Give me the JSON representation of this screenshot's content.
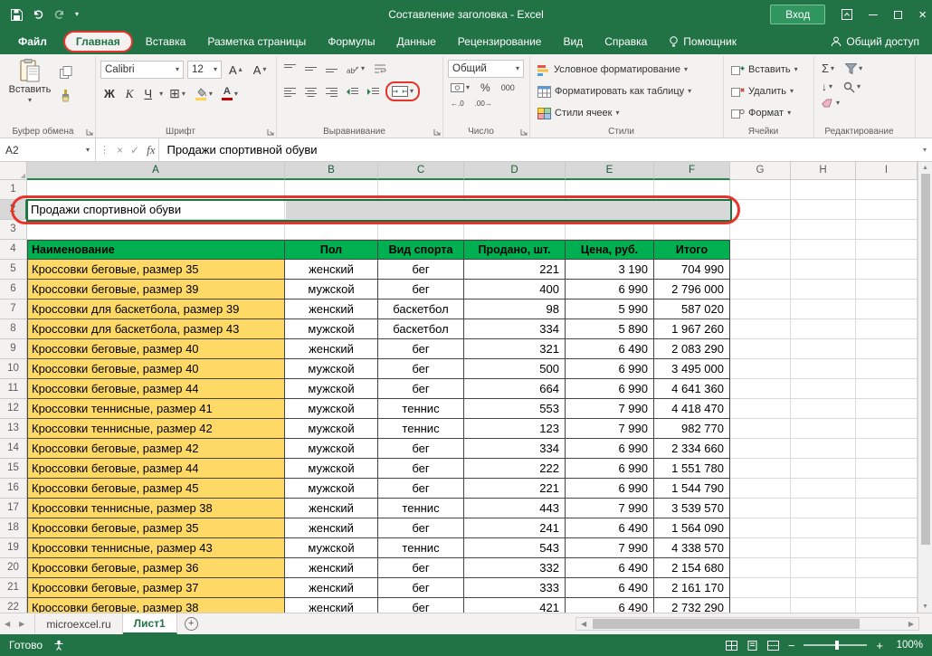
{
  "colors": {
    "excel_green": "#217346",
    "table_header_fill": "#00b050",
    "name_column_fill": "#ffd966",
    "selection_fill": "#d8d8d8",
    "annotation_red": "#e8352b"
  },
  "titlebar": {
    "title": "Составление заголовка  -  Excel",
    "sign_in": "Вход"
  },
  "tabs": {
    "file": "Файл",
    "items": [
      "Главная",
      "Вставка",
      "Разметка страницы",
      "Формулы",
      "Данные",
      "Рецензирование",
      "Вид",
      "Справка"
    ],
    "active": "Главная",
    "assistant": "Помощник",
    "share": "Общий доступ"
  },
  "ribbon": {
    "clipboard": {
      "label": "Буфер обмена",
      "paste": "Вставить"
    },
    "font": {
      "label": "Шрифт",
      "name": "Calibri",
      "size": "12",
      "bold": "Ж",
      "italic": "К",
      "underline": "Ч",
      "letter": "А"
    },
    "alignment": {
      "label": "Выравнивание",
      "wrap": "ab"
    },
    "number": {
      "label": "Число",
      "format": "Общий",
      "percent": "%",
      "thousands": "000"
    },
    "styles": {
      "label": "Стили",
      "conditional": "Условное форматирование",
      "format_table": "Форматировать как таблицу",
      "cell_styles": "Стили ячеек"
    },
    "cells": {
      "label": "Ячейки",
      "insert": "Вставить",
      "delete": "Удалить",
      "format": "Формат"
    },
    "editing": {
      "label": "Редактирование"
    }
  },
  "formula_bar": {
    "name_box": "A2",
    "fx": "fx",
    "content": "Продажи спортивной обуви"
  },
  "grid": {
    "columns": [
      "A",
      "B",
      "C",
      "D",
      "E",
      "F",
      "G",
      "H",
      "I"
    ],
    "selected_columns": 6,
    "selected_row": 2,
    "title_cell": {
      "ref": "A2",
      "text": "Продажи спортивной обуви"
    },
    "table": {
      "header_row_num": 4,
      "headers": [
        "Наименование",
        "Пол",
        "Вид спорта",
        "Продано, шт.",
        "Цена, руб.",
        "Итого"
      ],
      "first_data_row": 5,
      "rows": [
        [
          "Кроссовки беговые, размер 35",
          "женский",
          "бег",
          "221",
          "3 190",
          "704 990"
        ],
        [
          "Кроссовки беговые, размер 39",
          "мужской",
          "бег",
          "400",
          "6 990",
          "2 796 000"
        ],
        [
          "Кроссовки для баскетбола, размер 39",
          "женский",
          "баскетбол",
          "98",
          "5 990",
          "587 020"
        ],
        [
          "Кроссовки для баскетбола, размер 43",
          "мужской",
          "баскетбол",
          "334",
          "5 890",
          "1 967 260"
        ],
        [
          "Кроссовки беговые, размер 40",
          "женский",
          "бег",
          "321",
          "6 490",
          "2 083 290"
        ],
        [
          "Кроссовки беговые, размер 40",
          "мужской",
          "бег",
          "500",
          "6 990",
          "3 495 000"
        ],
        [
          "Кроссовки беговые, размер 44",
          "мужской",
          "бег",
          "664",
          "6 990",
          "4 641 360"
        ],
        [
          "Кроссовки теннисные, размер 41",
          "мужской",
          "теннис",
          "553",
          "7 990",
          "4 418 470"
        ],
        [
          "Кроссовки теннисные, размер 42",
          "мужской",
          "теннис",
          "123",
          "7 990",
          "982 770"
        ],
        [
          "Кроссовки беговые, размер 42",
          "мужской",
          "бег",
          "334",
          "6 990",
          "2 334 660"
        ],
        [
          "Кроссовки беговые, размер 44",
          "мужской",
          "бег",
          "222",
          "6 990",
          "1 551 780"
        ],
        [
          "Кроссовки беговые, размер 45",
          "мужской",
          "бег",
          "221",
          "6 990",
          "1 544 790"
        ],
        [
          "Кроссовки теннисные, размер 38",
          "женский",
          "теннис",
          "443",
          "7 990",
          "3 539 570"
        ],
        [
          "Кроссовки беговые, размер 35",
          "женский",
          "бег",
          "241",
          "6 490",
          "1 564 090"
        ],
        [
          "Кроссовки теннисные, размер 43",
          "мужской",
          "теннис",
          "543",
          "7 990",
          "4 338 570"
        ],
        [
          "Кроссовки беговые, размер 36",
          "женский",
          "бег",
          "332",
          "6 490",
          "2 154 680"
        ],
        [
          "Кроссовки беговые, размер 37",
          "женский",
          "бег",
          "333",
          "6 490",
          "2 161 170"
        ],
        [
          "Кроссовки беговые, размер 38",
          "женский",
          "бег",
          "421",
          "6 490",
          "2 732 290"
        ]
      ]
    }
  },
  "sheets": {
    "tabs": [
      {
        "name": "microexcel.ru",
        "active": false
      },
      {
        "name": "Лист1",
        "active": true
      }
    ]
  },
  "status": {
    "mode": "Готово",
    "zoom": "100%"
  },
  "icons": {
    "caret": "▾",
    "caret_up": "▴",
    "close": "×",
    "cancel": "×",
    "check": "✓",
    "sigma": "Σ",
    "arrow_down": "↓",
    "dots": "⋮",
    "corner": "◢",
    "left_tri": "◀",
    "right_tri": "▶",
    "up_tri": "▲",
    "down_tri": "▼",
    "inc_decimal": "←.0",
    "dec_decimal": ".00→"
  }
}
